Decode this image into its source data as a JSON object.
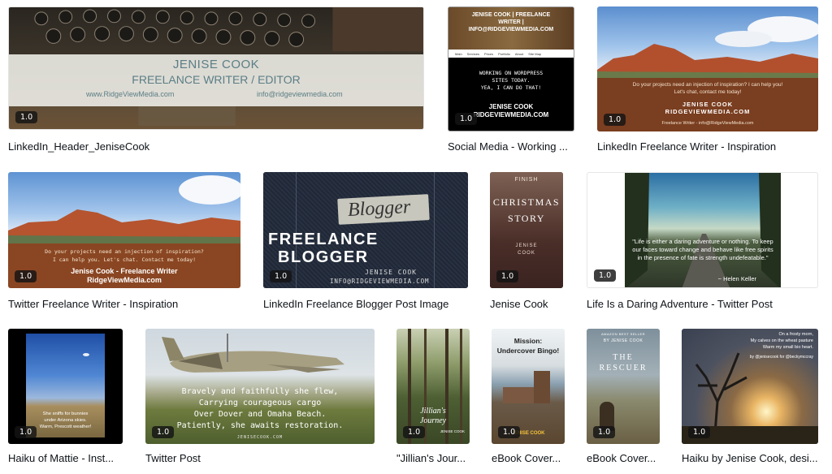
{
  "badge": "1.0",
  "cards": [
    {
      "caption": "LinkedIn_Header_JeniseCook",
      "line1": "JENISE COOK",
      "line2": "FREELANCE WRITER / EDITOR",
      "url": "www.RidgeViewMedia.com",
      "email": "info@ridgeviewmedia.com"
    },
    {
      "caption": "Social Media - Working ...",
      "head1": "JENISE COOK | FREELANCE",
      "head2": "WRITER |",
      "head3": "INFO@RIDGEVIEWMEDIA.COM",
      "nav": [
        "Main",
        "Services",
        "Prices",
        "Portfolio",
        "About",
        "Site Map"
      ],
      "msg1": "WORKING ON WORDPRESS",
      "msg2": "SITES TODAY.",
      "msg3": "YEA, I CAN DO THAT!",
      "name": "JENISE COOK",
      "site": "RIDGEVIEWMEDIA.COM"
    },
    {
      "caption": "LinkedIn Freelance Writer - Inspiration",
      "q1": "Do your projects need an injection of inspiration? I can help you!",
      "q2": "Let's chat, contact me today!",
      "name": "JENISE COOK",
      "site": "RIDGEVIEWMEDIA.COM",
      "foot": "Freelance Writer - info@RidgeViewMedia.com"
    },
    {
      "caption": "Twitter Freelance Writer - Inspiration",
      "q1": "Do your projects need an injection of inspiration?",
      "q2": "I can help you. Let's chat. Contact me today!",
      "name": "Jenise Cook - Freelance Writer",
      "site": "RidgeViewMedia.com"
    },
    {
      "caption": "LinkedIn Freelance Blogger Post Image",
      "tag": "Blogger",
      "big1": "FREELANCE",
      "big2": "BLOGGER",
      "name": "JENISE COOK",
      "email": "INFO@RIDGEVIEWMEDIA.COM"
    },
    {
      "caption": "Jenise Cook",
      "top": "FINISH",
      "title1": "CHRISTMAS",
      "title2": "STORY",
      "author1": "JENISE",
      "author2": "COOK"
    },
    {
      "caption": "Life Is a Daring Adventure - Twitter Post",
      "quote": "\"Life is either a daring adventure or nothing. To keep our faces toward change and behave like free spirits in the presence of fate is strength undefeatable.\"",
      "author": "~ Helen Keller"
    },
    {
      "caption": "Haiku of Mattie - Inst...",
      "poem1": "She sniffs for bunnies",
      "poem2": "under Arizona skies.",
      "poem3": "Warm, Prescott weather!"
    },
    {
      "caption": "Twitter Post",
      "l1": "Bravely and faithfully she flew,",
      "l2": "Carrying courageous cargo",
      "l3": "Over Dover and Omaha Beach.",
      "l4": "Patiently, she awaits restoration.",
      "site": "JENISECOOK.COM"
    },
    {
      "caption": "\"Jillian's Jour...",
      "title1": "Jillian's",
      "title2": "Journey",
      "author": "JENISE COOK"
    },
    {
      "caption": "eBook Cover...",
      "title1": "Mission:",
      "title2": "Undercover Bingo!",
      "author": "JENISE COOK"
    },
    {
      "caption": "eBook Cover...",
      "top": "AMAZON BEST SELLER",
      "author": "BY JENISE COOK",
      "title": "THE RESCUER"
    },
    {
      "caption": "Haiku by Jenise Cook, desi...",
      "p1": "On a frosty morn,",
      "p2": "My calves on the wheat pasture",
      "p3": "Warm my small bio heart.",
      "credit": "by @jenisecook for @beckymccray"
    }
  ]
}
